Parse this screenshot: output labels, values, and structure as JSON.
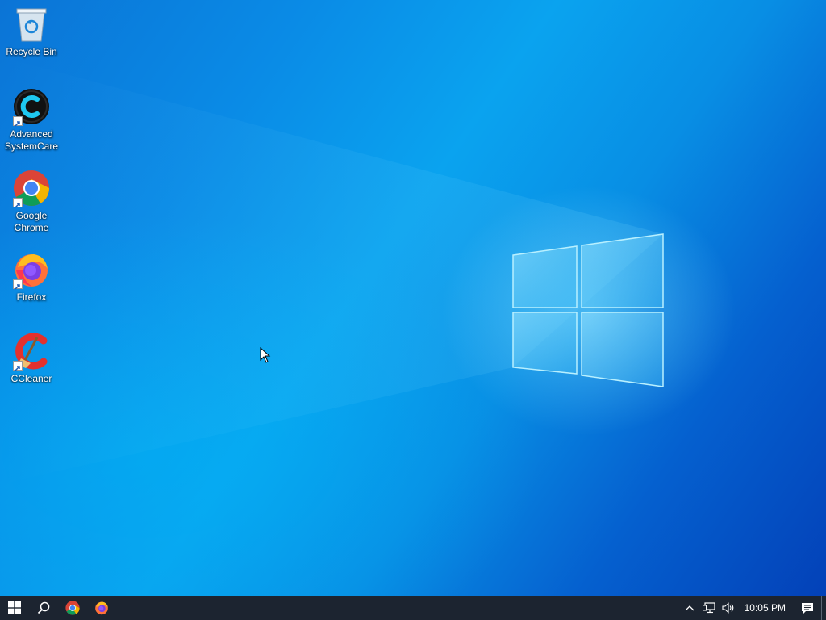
{
  "desktop": {
    "icons": [
      {
        "label": "Recycle Bin",
        "icon": "recycle-bin-icon"
      },
      {
        "label": "Advanced SystemCare",
        "icon": "advanced-systemcare-icon"
      },
      {
        "label": "Google Chrome",
        "icon": "chrome-icon"
      },
      {
        "label": "Firefox",
        "icon": "firefox-icon"
      },
      {
        "label": "CCleaner",
        "icon": "ccleaner-icon"
      }
    ],
    "wallpaper": {
      "primary": "#0a8be6",
      "dark": "#0341b8",
      "glow": "#78dcff"
    }
  },
  "taskbar": {
    "background": "#1c2430",
    "start_icon": "windows-start-icon",
    "search_icon": "search-icon",
    "pinned": [
      {
        "name": "Google Chrome",
        "icon": "chrome-icon"
      },
      {
        "name": "Firefox",
        "icon": "firefox-icon"
      }
    ],
    "tray": {
      "icons": [
        "chevron-up-icon",
        "network-icon",
        "volume-icon"
      ],
      "clock": "10:05 PM",
      "notification_icon": "action-center-icon"
    }
  }
}
